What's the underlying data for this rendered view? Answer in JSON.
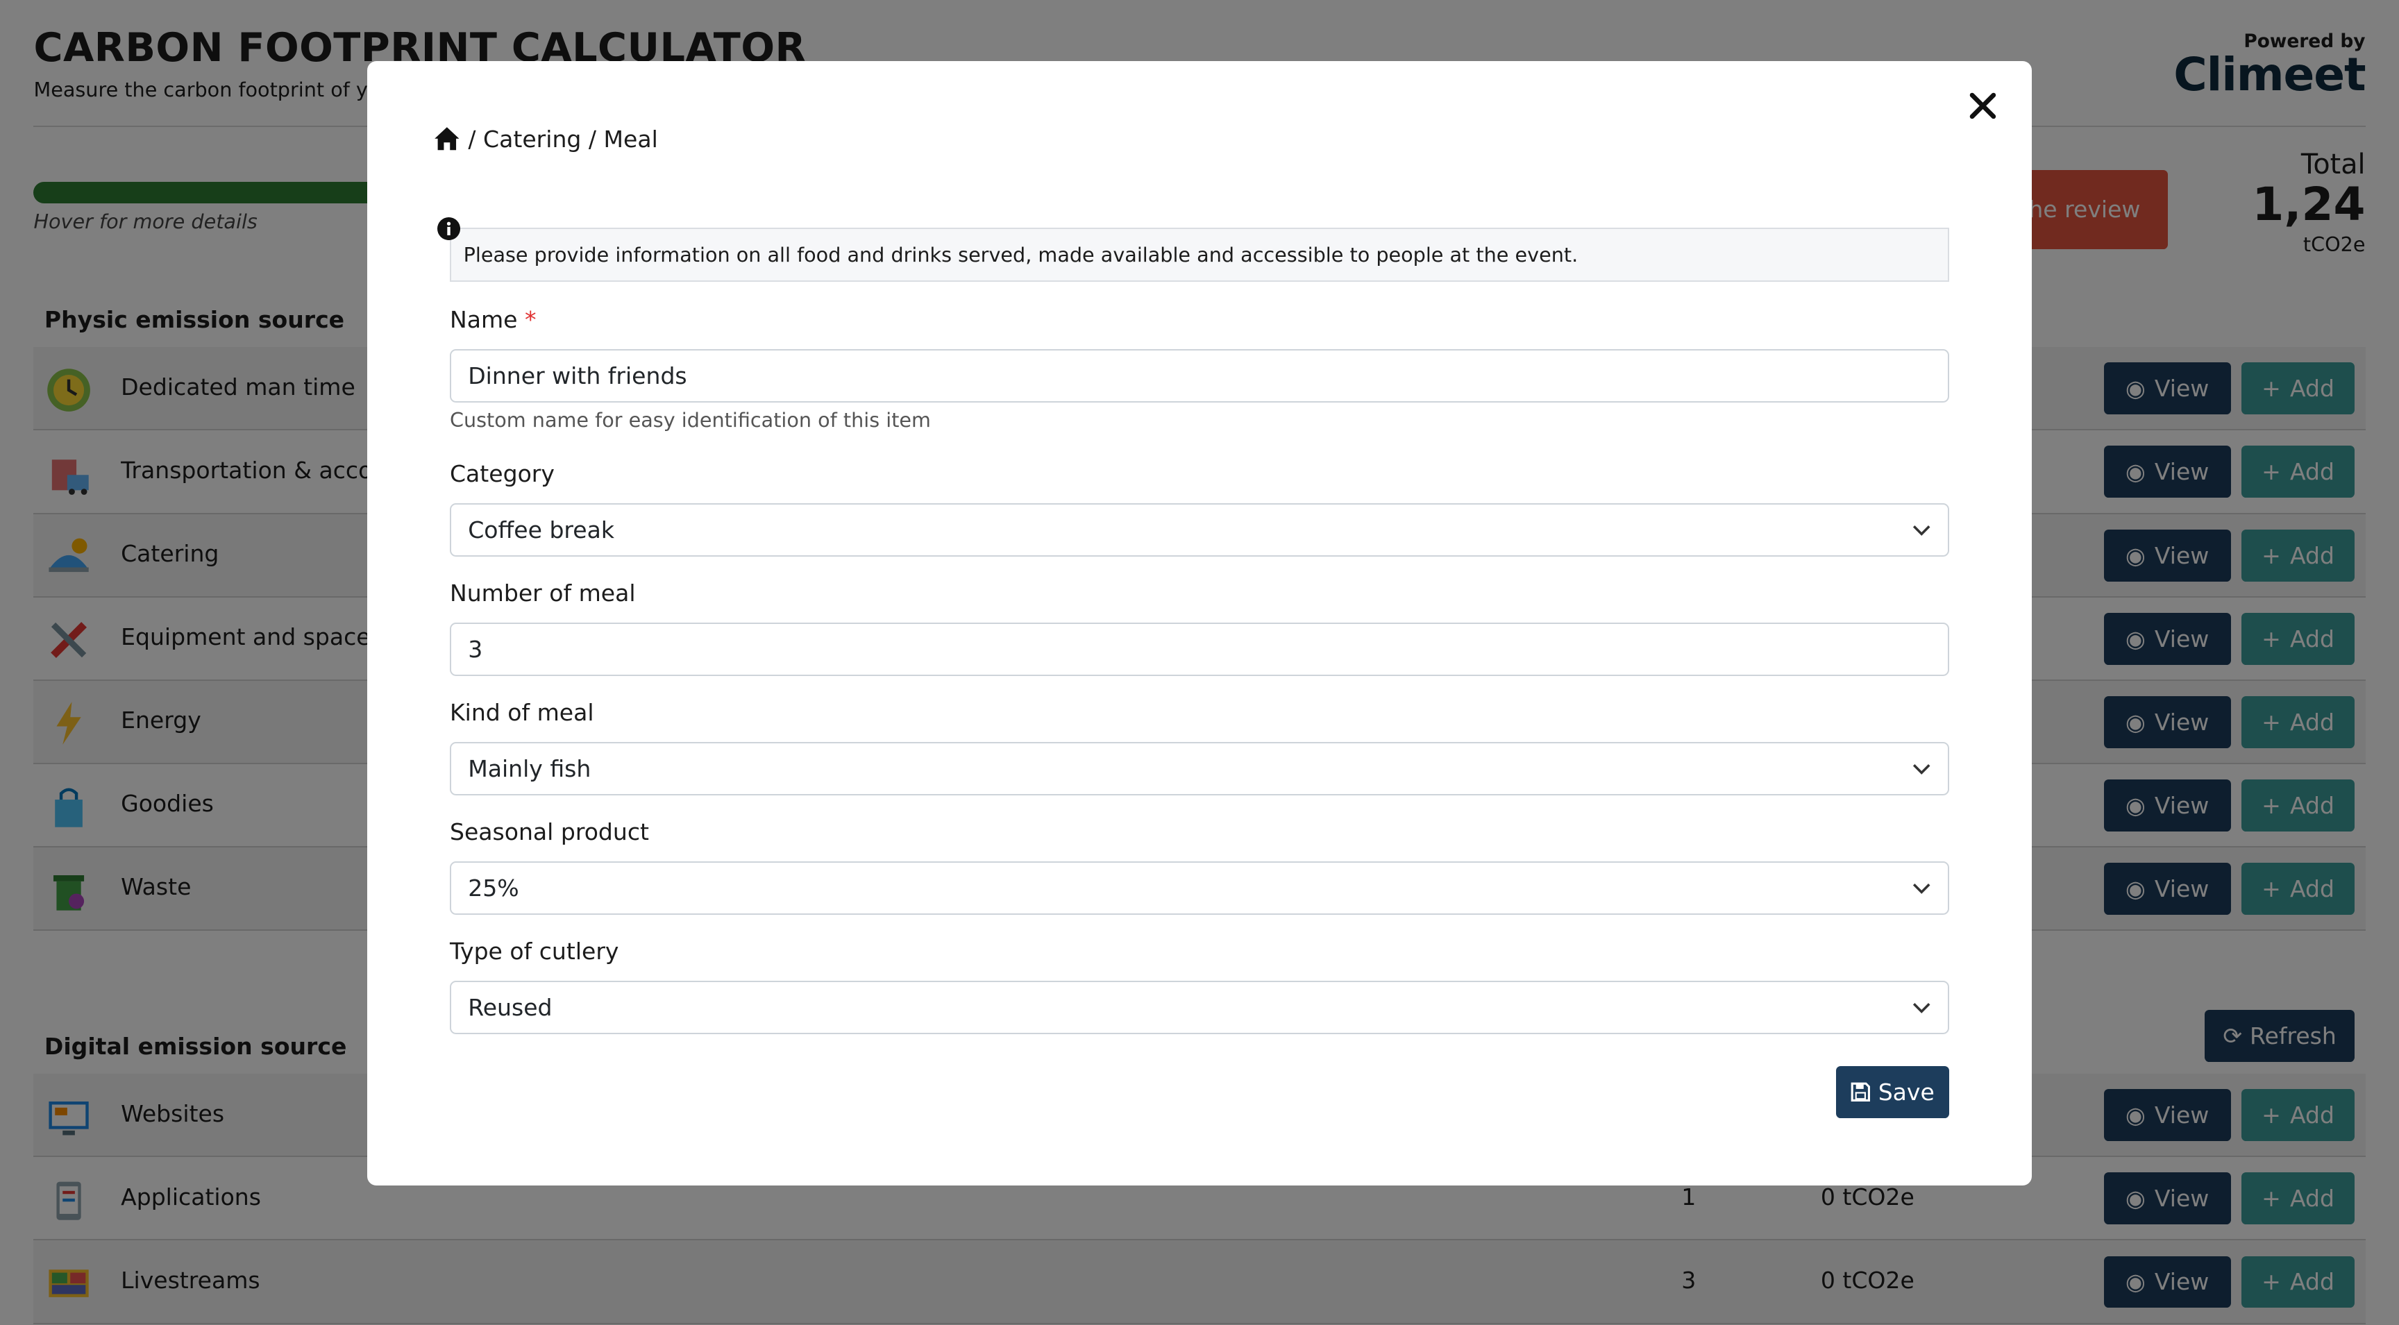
{
  "header": {
    "title": "CARBON FOOTPRINT CALCULATOR",
    "subtitle": "Measure the carbon footprint of yo",
    "powered_by": "Powered by",
    "brand": "Climeet",
    "hover_hint": "Hover for more details",
    "review_button": "the review"
  },
  "total": {
    "label": "Total",
    "value": "1,24",
    "unit": "tCO2e"
  },
  "physic": {
    "title": "Physic emission source",
    "rows": [
      {
        "label": "Dedicated man time",
        "icon": "clock-icon"
      },
      {
        "label": "Transportation & accom",
        "icon": "hotel-icon"
      },
      {
        "label": "Catering",
        "icon": "catering-icon"
      },
      {
        "label": "Equipment and space",
        "icon": "tools-icon"
      },
      {
        "label": "Energy",
        "icon": "lightning-icon"
      },
      {
        "label": "Goodies",
        "icon": "shopping-bag-icon"
      },
      {
        "label": "Waste",
        "icon": "recycle-bin-icon"
      }
    ]
  },
  "digital": {
    "title": "Digital emission source",
    "refresh_label": "Refresh",
    "rows": [
      {
        "label": "Websites",
        "count": "",
        "total": "",
        "icon": "website-icon"
      },
      {
        "label": "Applications",
        "count": "1",
        "total": "0 tCO2e",
        "icon": "app-icon"
      },
      {
        "label": "Livestreams",
        "count": "3",
        "total": "0 tCO2e",
        "icon": "livestream-icon"
      }
    ]
  },
  "buttons": {
    "view": "View",
    "add": "Add"
  },
  "modal": {
    "breadcrumb": "/ Catering / Meal",
    "info": "Please provide information on all food and drinks served, made available and accessible to people at the event.",
    "name_label": "Name",
    "required_mark": "*",
    "name_value": "Dinner with friends",
    "name_help": "Custom name for easy identification of this item",
    "category_label": "Category",
    "category_value": "Coffee break",
    "meals_label": "Number of meal",
    "meals_value": "3",
    "kind_label": "Kind of meal",
    "kind_value": "Mainly fish",
    "seasonal_label": "Seasonal product",
    "seasonal_value": "25%",
    "cutlery_label": "Type of cutlery",
    "cutlery_value": "Reused",
    "save_label": "Save"
  },
  "colors": {
    "navy": "#1d3d5c",
    "teal": "#3c9d9a",
    "review": "#e3553e",
    "progress": "#2e7d32"
  }
}
